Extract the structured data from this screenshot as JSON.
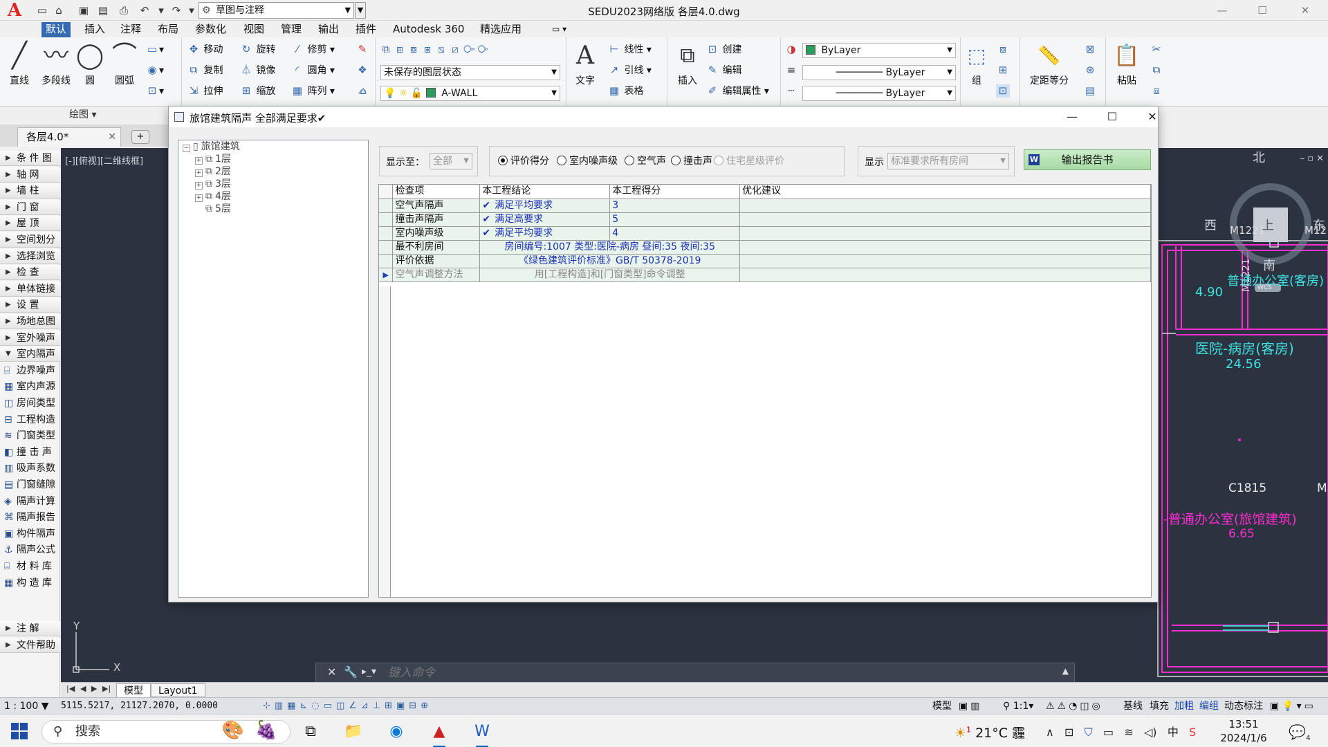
{
  "app": {
    "window_title": "SEDU2023网络版    各层4.0.dwg",
    "workspace": "草图与注释"
  },
  "ribbon": {
    "tabs": [
      "默认",
      "插入",
      "注释",
      "布局",
      "参数化",
      "视图",
      "管理",
      "输出",
      "插件",
      "Autodesk 360",
      "精选应用"
    ],
    "draw": {
      "line": "直线",
      "polyline": "多段线",
      "circle": "圆",
      "arc": "圆弧",
      "panel_label": "绘图"
    },
    "modify": {
      "move": "移动",
      "rotate": "旋转",
      "trim": "修剪",
      "copy": "复制",
      "mirror": "镜像",
      "fillet": "圆角",
      "stretch": "拉伸",
      "scale": "缩放",
      "array": "阵列"
    },
    "layers": {
      "state": "未保存的图层状态",
      "current": "A-WALL"
    },
    "annotation": {
      "text": "文字",
      "linear": "线性",
      "leader": "引线",
      "table": "表格"
    },
    "block": {
      "insert": "插入",
      "create": "创建",
      "edit": "编辑",
      "edit_attr": "编辑属性"
    },
    "properties": {
      "color": "ByLayer",
      "linetype": "ByLayer",
      "lineweight": "ByLayer"
    },
    "groups": {
      "group": "组"
    },
    "utilities": {
      "measure": "定距等分"
    },
    "clipboard": {
      "paste": "粘贴"
    }
  },
  "doc_tab": {
    "name": "各层4.0*"
  },
  "palette": [
    {
      "label": "条 件 图",
      "type": "group"
    },
    {
      "label": "轴    网",
      "type": "group"
    },
    {
      "label": "墙    柱",
      "type": "group"
    },
    {
      "label": "门    窗",
      "type": "group"
    },
    {
      "label": "屋    顶",
      "type": "group"
    },
    {
      "label": "空间划分",
      "type": "group"
    },
    {
      "label": "选择浏览",
      "type": "group"
    },
    {
      "label": "检    查",
      "type": "group"
    },
    {
      "label": "单体链接",
      "type": "group"
    },
    {
      "label": "设    置",
      "type": "group"
    },
    {
      "label": "场地总图",
      "type": "group"
    },
    {
      "label": "室外噪声",
      "type": "group"
    },
    {
      "label": "室内隔声",
      "type": "group-open"
    },
    {
      "label": "边界噪声",
      "type": "tool"
    },
    {
      "label": "室内声源",
      "type": "tool"
    },
    {
      "label": "房间类型",
      "type": "tool"
    },
    {
      "label": "工程构造",
      "type": "tool"
    },
    {
      "label": "门窗类型",
      "type": "tool"
    },
    {
      "label": "撞 击 声",
      "type": "tool"
    },
    {
      "label": "吸声系数",
      "type": "tool"
    },
    {
      "label": "门窗缝隙",
      "type": "tool"
    },
    {
      "label": "隔声计算",
      "type": "tool"
    },
    {
      "label": "隔声报告",
      "type": "tool"
    },
    {
      "label": "构件隔声",
      "type": "tool"
    },
    {
      "label": "隔声公式",
      "type": "tool"
    },
    {
      "label": "材 料 库",
      "type": "tool"
    },
    {
      "label": "构 造 库",
      "type": "tool"
    },
    {
      "label": "注    解",
      "type": "group"
    },
    {
      "label": "文件帮助",
      "type": "group"
    }
  ],
  "canvas": {
    "viewport_label": "[-][俯视][二维线框]",
    "compass": {
      "north": "北",
      "south": "南",
      "west": "西",
      "east": "东",
      "top": "上",
      "wcs": "WCS"
    },
    "rooms": [
      {
        "name": "医院-病房(客房)",
        "area": "24.56"
      },
      {
        "name": "普通办公室(客房)",
        "area": "4.90"
      },
      {
        "name": "-普通办公室(旅馆建筑)",
        "area": "6.65"
      }
    ],
    "tags": {
      "door_top": "M1221",
      "door_right": "M12",
      "door_vertical": "M1221",
      "window": "C1815",
      "m_right": "M"
    },
    "axes": {
      "y": "Y",
      "x": "X"
    }
  },
  "cmdline": {
    "placeholder": "键入命令"
  },
  "layout_tabs": {
    "model": "模型",
    "layout1": "Layout1"
  },
  "statusbar": {
    "scale": "1 : 100",
    "coords": "5115.5217,  21127.2070,  0.0000",
    "model": "模型",
    "annot_scale": "1:1",
    "right_items": [
      "基线",
      "填充",
      "加粗",
      "编组",
      "动态标注"
    ]
  },
  "taskbar": {
    "search": "搜索",
    "temp": "21°C",
    "weather_glyph": "霾",
    "ime": "中",
    "time": "13:51",
    "date": "2024/1/6",
    "notif_count": "4",
    "weather_badge": "1"
  },
  "dialog": {
    "title": "旅馆建筑隔声   全部满足要求✔",
    "tree": {
      "root": "旅馆建筑",
      "floors": [
        "1层",
        "2层",
        "3层",
        "4层",
        "5层"
      ]
    },
    "show_to": {
      "label": "显示至：",
      "value": "全部"
    },
    "radios": [
      {
        "label": "评价得分",
        "checked": true,
        "disabled": false
      },
      {
        "label": "室内噪声级",
        "checked": false,
        "disabled": false
      },
      {
        "label": "空气声",
        "checked": false,
        "disabled": false
      },
      {
        "label": "撞击声",
        "checked": false,
        "disabled": false
      },
      {
        "label": "住宅星级评价",
        "checked": false,
        "disabled": true
      }
    ],
    "display": {
      "label": "显示",
      "value": "标准要求所有房间"
    },
    "report_button": "输出报告书",
    "columns": [
      "检查项",
      "本工程结论",
      "本工程得分",
      "优化建议"
    ],
    "rows": [
      {
        "item": "空气声隔声",
        "conclusion": "满足平均要求",
        "check": true,
        "score": "3",
        "advice": ""
      },
      {
        "item": "撞击声隔声",
        "conclusion": "满足高要求",
        "check": true,
        "score": "5",
        "advice": ""
      },
      {
        "item": "室内噪声级",
        "conclusion": "满足平均要求",
        "check": true,
        "score": "4",
        "advice": ""
      },
      {
        "item": "最不利房间",
        "conclusion": "房间编号:1007 类型:医院-病房 昼间:35 夜间:35",
        "span": true,
        "advice": ""
      },
      {
        "item": "评价依据",
        "conclusion": "《绿色建筑评价标准》GB/T 50378-2019",
        "span": true,
        "advice": ""
      },
      {
        "item": "空气声调整方法",
        "conclusion": "用[工程构造]和[门窗类型]命令调整",
        "span": true,
        "muted": true,
        "current": true,
        "advice": ""
      }
    ],
    "check_glyph": "✔",
    "current_glyph": "▶"
  }
}
